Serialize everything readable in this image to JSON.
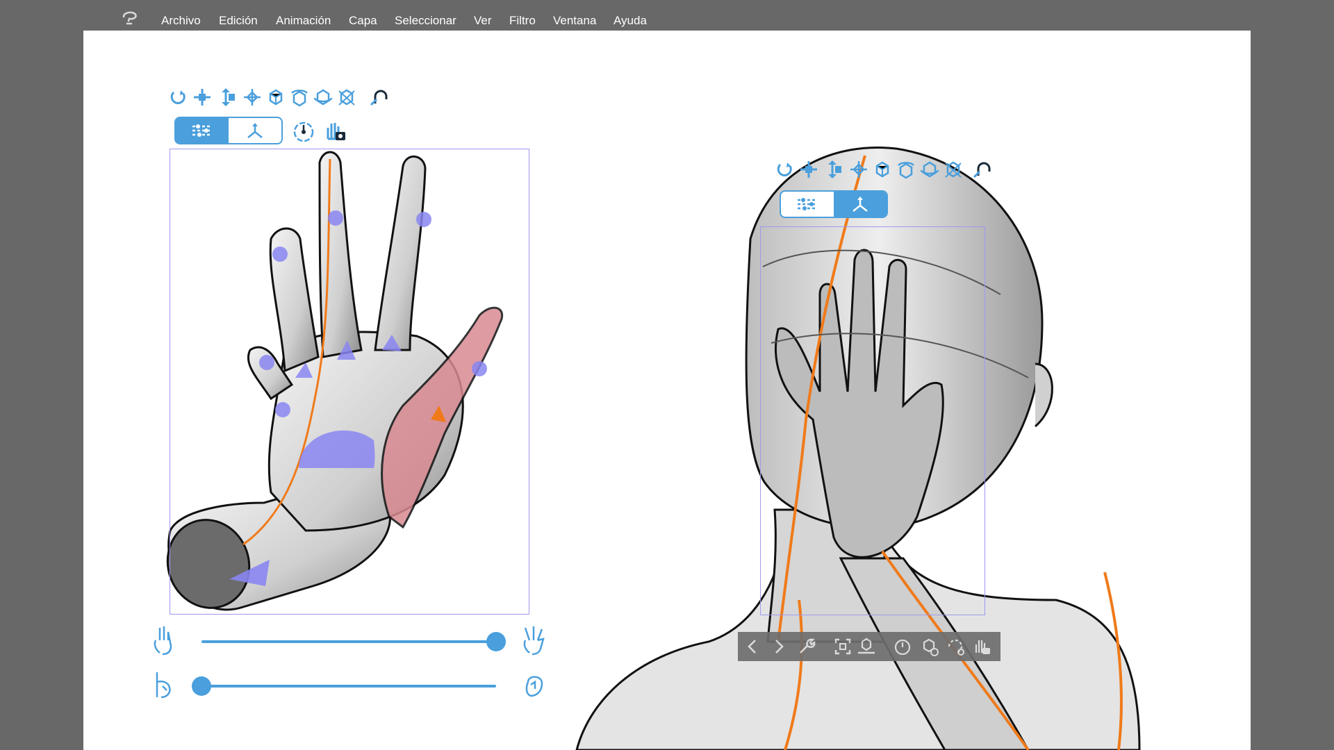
{
  "menu": {
    "app_logo_icon": "clip-studio-logo-icon",
    "items": [
      "Archivo",
      "Edición",
      "Animación",
      "Capa",
      "Seleccionar",
      "Ver",
      "Filtro",
      "Ventana",
      "Ayuda"
    ]
  },
  "hand_panel": {
    "toolbar_icons": [
      "rotate-icon",
      "move-xy-icon",
      "move-z-icon",
      "pan-icon",
      "rotate-camera-icon",
      "rotate-x-icon",
      "rotate-y-icon",
      "rotate-z-icon",
      "magnet-icon"
    ],
    "mode_buttons": [
      {
        "name": "sliders-mode-icon",
        "selected": true
      },
      {
        "name": "gizmo-mode-icon",
        "selected": false
      }
    ],
    "extra_icons": [
      "timer-icon",
      "hand-capture-icon"
    ],
    "sliders": [
      {
        "name": "spread-slider",
        "start_icon": "hand-closed-fingers-icon",
        "end_icon": "hand-spread-fingers-icon",
        "value": 1.0
      },
      {
        "name": "grip-slider",
        "start_icon": "hand-open-icon",
        "end_icon": "hand-fist-icon",
        "value": 0.0
      }
    ]
  },
  "figure_panel": {
    "toolbar_icons": [
      "rotate-icon",
      "move-xy-icon",
      "move-z-icon",
      "pan-icon",
      "rotate-camera-icon",
      "rotate-x-icon",
      "rotate-y-icon",
      "rotate-z-icon",
      "magnet-icon"
    ],
    "mode_buttons": [
      {
        "name": "sliders-mode-icon",
        "selected": false
      },
      {
        "name": "gizmo-mode-icon",
        "selected": true
      }
    ]
  },
  "bottom_toolbar": {
    "icons": [
      "chevron-left-icon",
      "chevron-right-icon",
      "wrench-icon",
      "fit-frame-icon",
      "ground-icon",
      "timer-icon",
      "model-reset-icon",
      "rotate-reset-icon",
      "hand-capture-icon"
    ]
  },
  "colors": {
    "accent": "#4a9fdc",
    "menubar": "#686868",
    "canvas": "#ffffff",
    "guide_line": "#f07a1a",
    "joint_handle": "#8a86f2",
    "selection_box": "#9d99ee",
    "selected_part": "#d98a92"
  }
}
